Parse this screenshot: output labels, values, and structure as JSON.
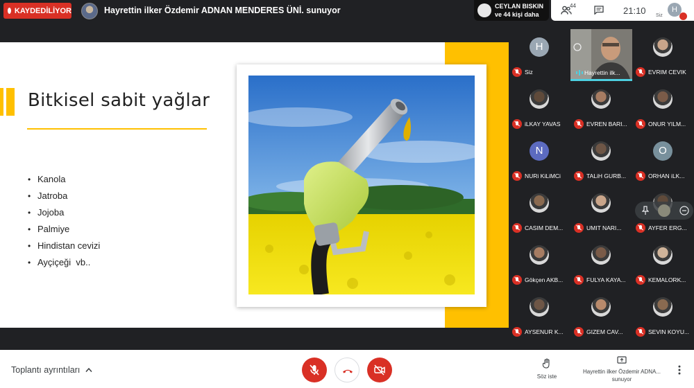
{
  "header": {
    "recording_label": "KAYDEDİLİYOR",
    "presenter_title": "Hayrettin ilker Özdemir ADNAN MENDERES ÜNİ. sunuyor"
  },
  "notification": {
    "name": "CEYLAN BISKIN",
    "more": "ve 44 kişi daha"
  },
  "top_panel": {
    "participant_count": "44",
    "time": "21:10",
    "self_initial": "H",
    "self_label": "Siz"
  },
  "slide": {
    "title": "Bitkisel sabit yağlar",
    "bullets": [
      "Kanola",
      "Jatroba",
      "Jojoba",
      "Palmiye",
      "Hindistan cevizi",
      "Ayçiçeği  vb.."
    ]
  },
  "participants": [
    {
      "name": "Siz",
      "initial": "H",
      "color": "#9aa7b3"
    },
    {
      "name": "Hayrettin ilk...",
      "speaking": true
    },
    {
      "name": "EVRIM CEVIK"
    },
    {
      "name": "iLKAY YAVAS"
    },
    {
      "name": "EVREN BARI..."
    },
    {
      "name": "ONUR YILM..."
    },
    {
      "name": "NURi KiLiMCi",
      "initial": "N",
      "color": "#5c6bc0"
    },
    {
      "name": "TALiH GURB..."
    },
    {
      "name": "ORHAN iLK...",
      "initial": "O",
      "color": "#78909c"
    },
    {
      "name": "CASIM DEM..."
    },
    {
      "name": "UMIT NARI..."
    },
    {
      "name": "AYFER ERG..."
    },
    {
      "name": "Gökçen AKB..."
    },
    {
      "name": "FULYA KAYA..."
    },
    {
      "name": "KEMALORK..."
    },
    {
      "name": "AYSENUR K..."
    },
    {
      "name": "GIZEM CAV..."
    },
    {
      "name": "SEVIN KOYU..."
    }
  ],
  "bottom": {
    "meeting_details": "Toplantı ayrıntıları",
    "raise_hand": "Söz iste",
    "presenting_line1": "Hayrettin ilker Özdemir ADNA...",
    "presenting_line2": "sunuyor"
  },
  "colors": {
    "accent_red": "#d93025",
    "slide_yellow": "#ffc000",
    "speaker_highlight": "#4dd0e1"
  }
}
